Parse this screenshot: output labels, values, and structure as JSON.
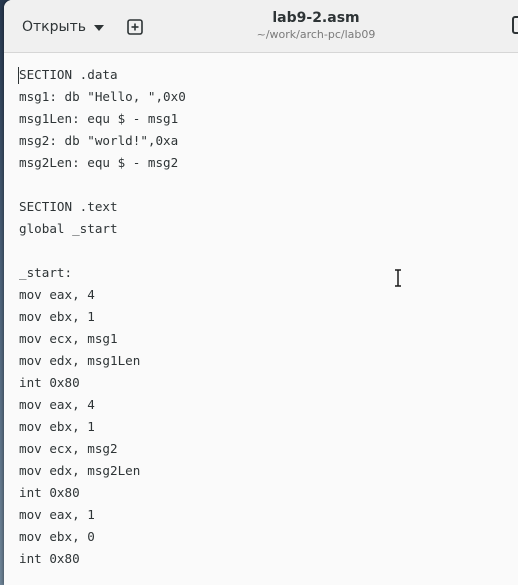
{
  "headerbar": {
    "open_label": "Открыть",
    "title": "lab9-2.asm",
    "subtitle": "~/work/arch-pc/lab09"
  },
  "icons": {
    "open_dropdown": "chevron-down-icon",
    "new_tab": "new-tab-plus-icon",
    "mouse_cursor": "text-ibeam-cursor-icon"
  },
  "editor": {
    "lines": [
      "SECTION .data",
      "msg1: db \"Hello, \",0x0",
      "msg1Len: equ $ - msg1",
      "msg2: db \"world!\",0xa",
      "msg2Len: equ $ - msg2",
      "",
      "SECTION .text",
      "global _start",
      "",
      "_start:",
      "mov eax, 4",
      "mov ebx, 1",
      "mov ecx, msg1",
      "mov edx, msg1Len",
      "int 0x80",
      "mov eax, 4",
      "mov ebx, 1",
      "mov ecx, msg2",
      "mov edx, msg2Len",
      "int 0x80",
      "mov eax, 1",
      "mov ebx, 0",
      "int 0x80"
    ]
  },
  "colors": {
    "spellcheck_underline": "#e01b24",
    "text": "#2e3436",
    "editor_background": "#fafafa",
    "headerbar_background": "#f0f0f0"
  }
}
